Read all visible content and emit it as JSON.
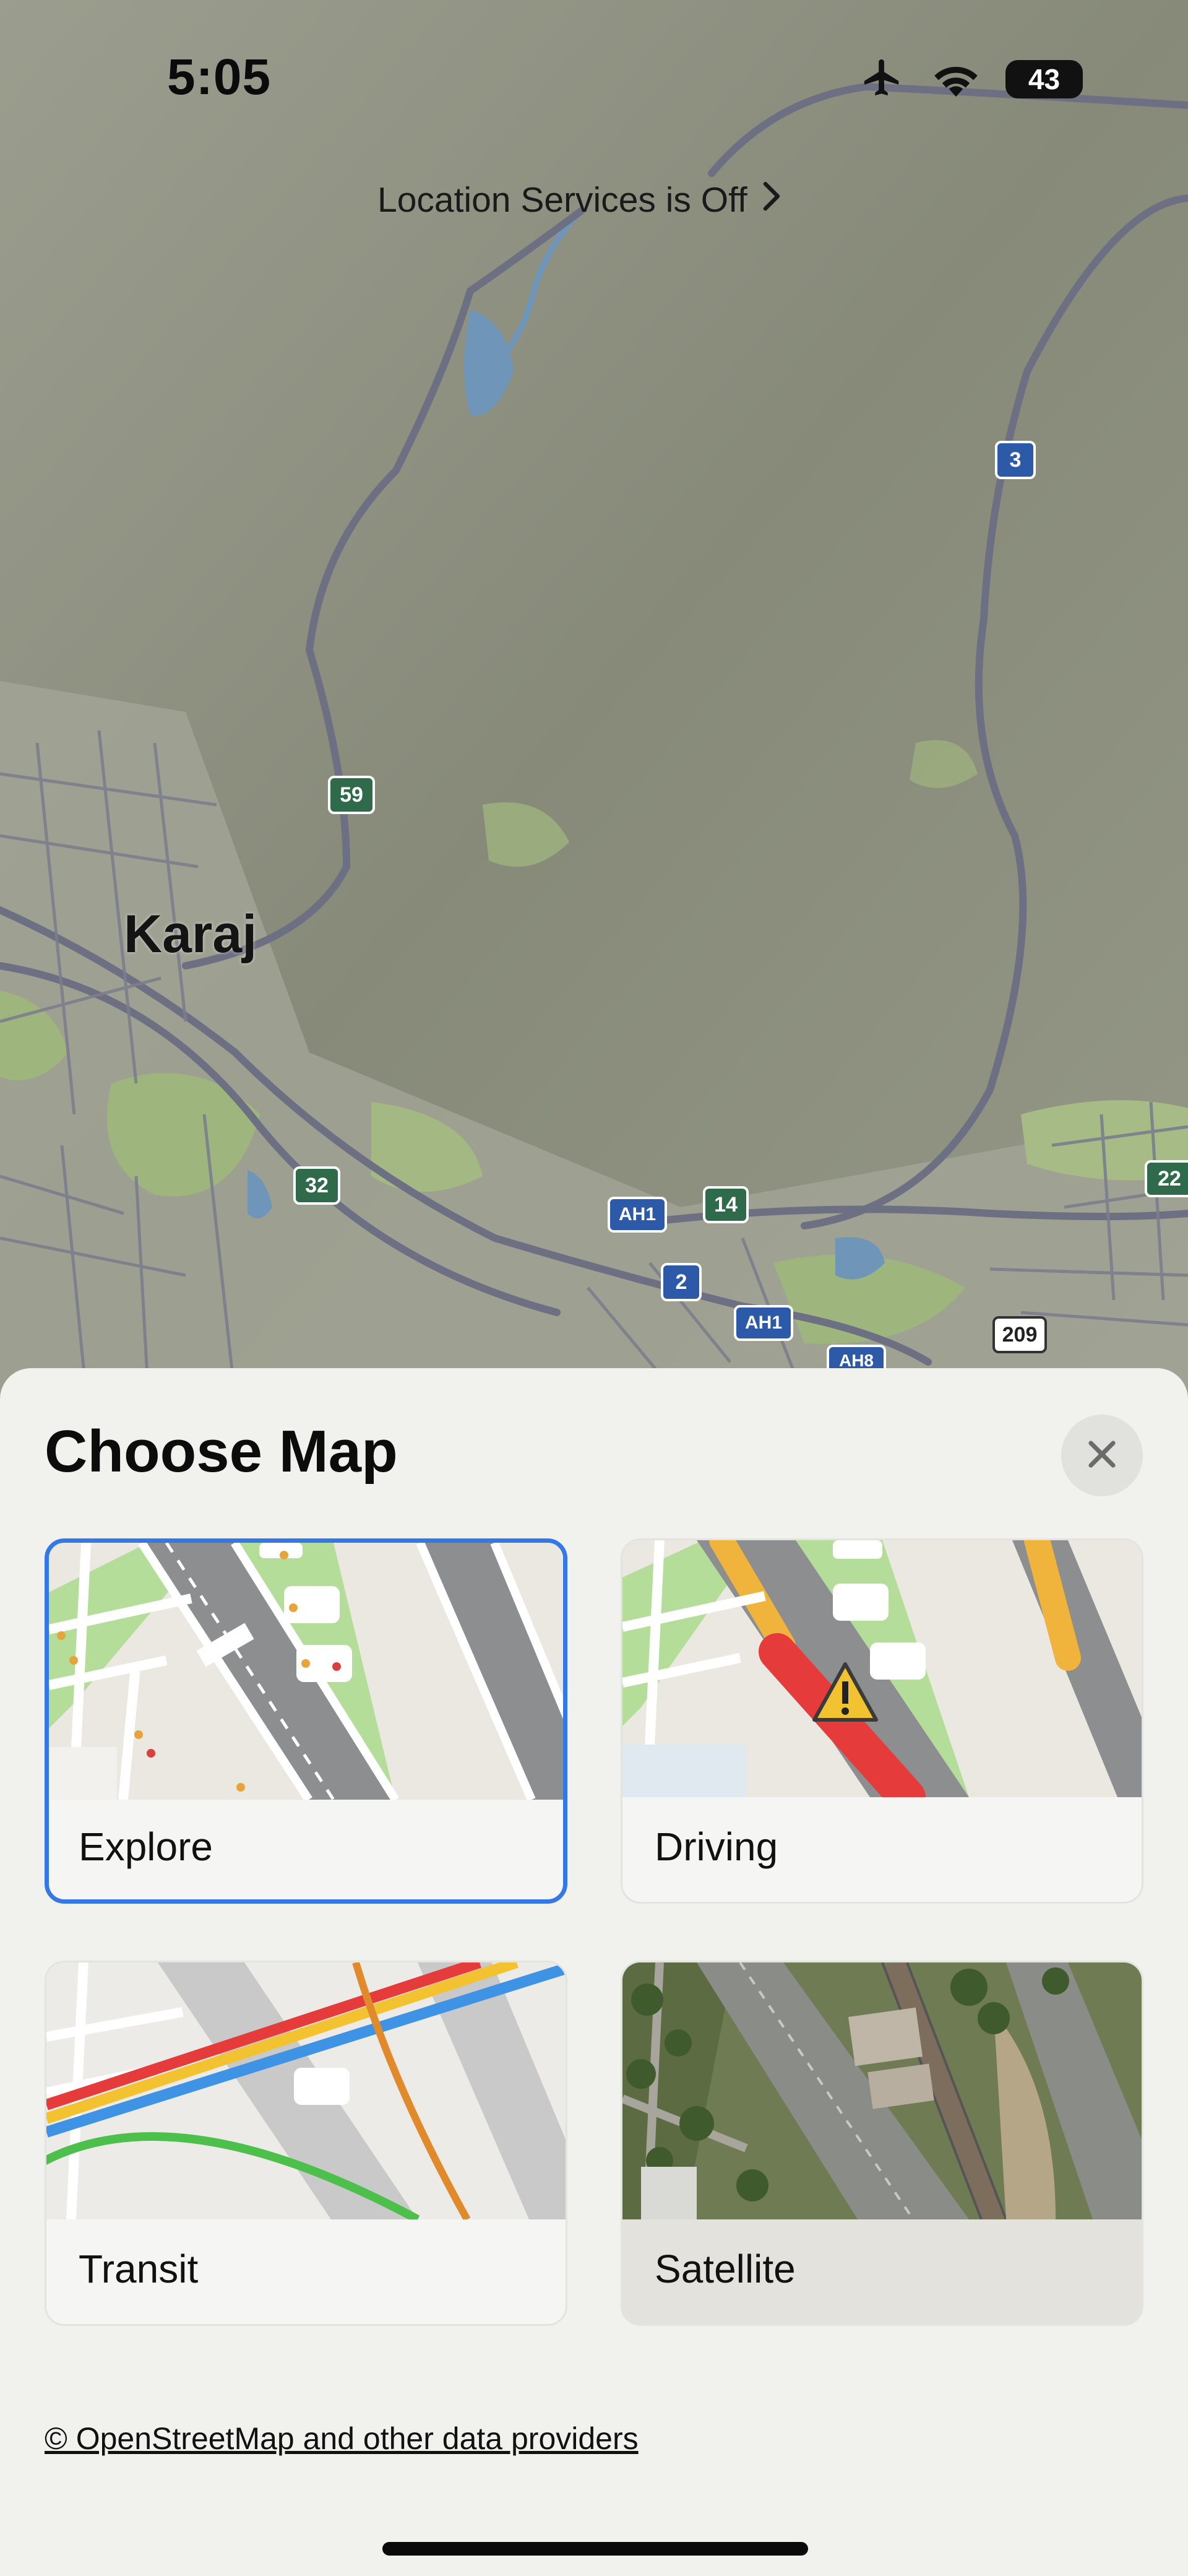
{
  "status_bar": {
    "time": "5:05",
    "battery_level": "43",
    "icons": [
      "airplane-icon",
      "wifi-icon",
      "battery-icon"
    ]
  },
  "map": {
    "location_banner": "Location Services is Off",
    "city_label": "Karaj",
    "road_shields": [
      "3",
      "59",
      "32",
      "AH1",
      "14",
      "2",
      "AH1",
      "209",
      "22",
      "AH8"
    ]
  },
  "sheet": {
    "title": "Choose Map",
    "options": [
      {
        "label": "Explore",
        "selected": true
      },
      {
        "label": "Driving",
        "selected": false
      },
      {
        "label": "Transit",
        "selected": false
      },
      {
        "label": "Satellite",
        "selected": false
      }
    ],
    "attribution": "© OpenStreetMap and other data providers"
  },
  "colors": {
    "accent": "#3478e8",
    "sheet_background": "#f1f2ee",
    "map_terrain": "#8f9282",
    "park_green": "#a9c586"
  }
}
